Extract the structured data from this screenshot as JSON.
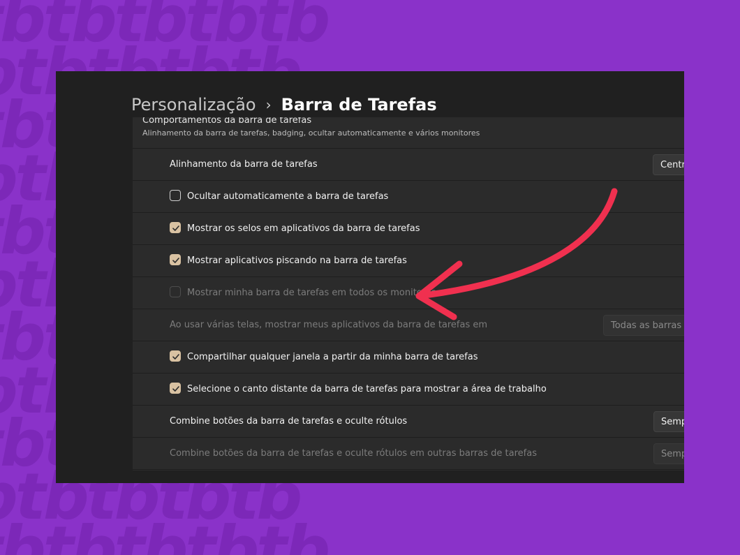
{
  "breadcrumb": {
    "parent": "Personalização",
    "separator": "›",
    "current": "Barra de Tarefas"
  },
  "section": {
    "title": "Comportamentos da barra de tarefas",
    "subtitle": "Alinhamento da barra de tarefas, badging, ocultar automaticamente e vários monitores"
  },
  "rows": [
    {
      "label": "Alinhamento da barra de tarefas",
      "control": "dropdown",
      "value": "Centro"
    },
    {
      "label": "Ocultar automaticamente a barra de tarefas",
      "control": "checkbox",
      "checked": false
    },
    {
      "label": "Mostrar os selos em aplicativos da barra de tarefas",
      "control": "checkbox",
      "checked": true
    },
    {
      "label": "Mostrar aplicativos piscando na barra de tarefas",
      "control": "checkbox",
      "checked": true
    },
    {
      "label": "Mostrar minha barra de tarefas em todos os monitores",
      "control": "checkbox",
      "checked": false,
      "disabled": true
    },
    {
      "label": "Ao usar várias telas, mostrar meus aplicativos da barra de tarefas em",
      "control": "dropdown",
      "value": "Todas as barras de",
      "disabled": true
    },
    {
      "label": "Compartilhar qualquer janela a partir da minha barra de tarefas",
      "control": "checkbox",
      "checked": true
    },
    {
      "label": "Selecione o canto distante da barra de tarefas para mostrar a área de trabalho",
      "control": "checkbox",
      "checked": true
    },
    {
      "label": "Combine botões da barra de tarefas e oculte rótulos",
      "control": "dropdown",
      "value": "Sempre"
    },
    {
      "label": "Combine botões da barra de tarefas e oculte rótulos em outras barras de tarefas",
      "control": "dropdown",
      "value": "Sempre",
      "disabled": true
    }
  ],
  "background_watermark": "tbtbtbtbtb",
  "colors": {
    "background": "#8a32c9",
    "window": "#202020",
    "panel": "#2b2b2b",
    "checkbox_accent": "#d9c2a2",
    "arrow": "#f0304f"
  },
  "icons": {
    "check": "checkmark-icon",
    "separator": "chevron-right-icon",
    "annotation": "curved-arrow-icon"
  }
}
